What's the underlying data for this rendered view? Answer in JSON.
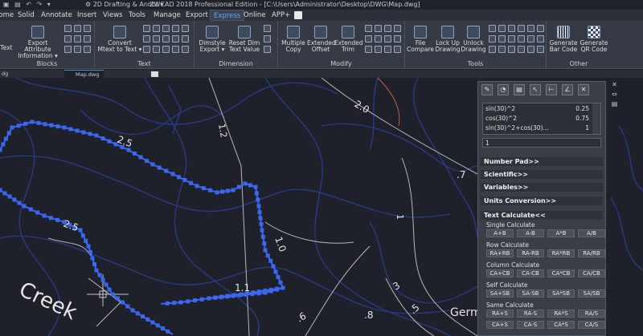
{
  "titlebar": {
    "workspace": "2D Drafting & Annot",
    "title": "ZWCAD 2018 Professional Edition - [C:\\Users\\Administrator\\Desktop\\DWG\\Map.dwg]"
  },
  "menu": [
    "Home",
    "Solid",
    "Annotate",
    "Insert",
    "Views",
    "Tools",
    "Manage",
    "Export",
    "Express",
    "Online",
    "APP+"
  ],
  "ribbon": {
    "groups": [
      "Blocks",
      "Text",
      "Dimension",
      "Modify",
      "Tools",
      "Other"
    ],
    "text_btn": "Text",
    "export_attr": [
      "Export Attribute",
      "Information"
    ],
    "convert": [
      "Convert",
      "Mtext to Text"
    ],
    "dimstyle": [
      "Dimstyle",
      "Export"
    ],
    "reset_dim": [
      "Reset Dim",
      "Text Value"
    ],
    "multiple_copy": [
      "Multiple",
      "Copy"
    ],
    "extended_offset": [
      "Extended",
      "Offset"
    ],
    "extended_trim": [
      "Extended",
      "Trim"
    ],
    "file_compare": [
      "File",
      "Compare"
    ],
    "lock_up": [
      "Lock Up",
      "Drawing"
    ],
    "unlock": [
      "Unlock",
      "Drawing"
    ],
    "gen_bar": [
      "Generate",
      "Bar Code"
    ],
    "gen_qr": [
      "Generate",
      "QR Code"
    ]
  },
  "tabs": {
    "left": "dg",
    "current": "Map.dwg"
  },
  "drawing": {
    "labels": [
      "2.5",
      "1.2",
      "2.0",
      "2.5",
      "1.0",
      "1.1",
      ".7",
      "1",
      "3",
      ".8",
      ".5",
      ".6",
      "Creek",
      "Germ"
    ]
  },
  "calculator": {
    "history": [
      {
        "expr": "sin(30)^2",
        "val": "0.25"
      },
      {
        "expr": "cos(30)^2",
        "val": "0.75"
      },
      {
        "expr": "sin(30)^2+cos(30)...",
        "val": "1"
      }
    ],
    "input": "1",
    "sections": [
      "Number Pad>>",
      "Scientific>>",
      "Variables>>",
      "Units Conversion>>",
      "Text Calculate<<"
    ],
    "single": {
      "label": "Single Calculate",
      "buttons": [
        "A+B",
        "A-B",
        "A*B",
        "A/B"
      ]
    },
    "row": {
      "label": "Row Calculate",
      "buttons": [
        "RA+RB",
        "RA-RB",
        "RA*RB",
        "RA/RB"
      ]
    },
    "column": {
      "label": "Column Calculate",
      "buttons": [
        "CA+CB",
        "CA-CB",
        "CA*CB",
        "CA/CB"
      ]
    },
    "self": {
      "label": "Self Calculate",
      "buttons": [
        "SA+SB",
        "SA-SB",
        "SA*SB",
        "SA/SB"
      ]
    },
    "same": {
      "label": "Same Calculate",
      "buttons": [
        "RA+S",
        "RA-S",
        "RA*S",
        "RA/S",
        "CA+S",
        "CA-S",
        "CA*S",
        "CA/S"
      ]
    }
  },
  "colors": {
    "background": "#1e2129",
    "polyline": "#3a66f0",
    "contour": "#2a3a8a",
    "accent": "#5aa8ff"
  }
}
